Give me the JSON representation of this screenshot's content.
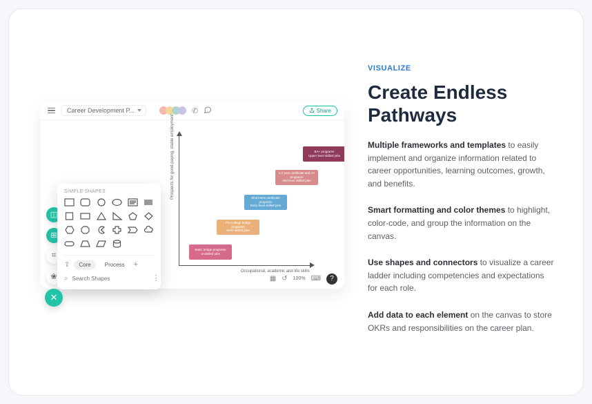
{
  "toolbar": {
    "doc_title": "Career Development P...",
    "share_label": "Share"
  },
  "axes": {
    "ylabel": "Prospects  for  good-paying,  stable  employment",
    "xlabel": "Occupational,  academic  and  life  skills"
  },
  "blocks": {
    "b1": {
      "line1": "BA+ programs",
      "line2": "Upper  level  skilled  jobs"
    },
    "b2": {
      "line1": "1-2 year  certificate  and  AA programs",
      "line2": "Mid-level  skilled  jobs"
    },
    "b3": {
      "line1": "Short-term  certificate  programs",
      "line2": "Entry  level  skilled  jobs"
    },
    "b4": {
      "line1": "Pre-college  bridge  programs",
      "line2": "Semi-skilled  jobs"
    },
    "b5": {
      "line1": "Basic  bridge  programs",
      "line2": "Unskilled  jobs"
    }
  },
  "panel": {
    "title": "SIMPLE SHAPES",
    "tag_core": "Core",
    "tag_process": "Process",
    "search_placeholder": "Search Shapes"
  },
  "bottombar": {
    "zoom": "100%"
  },
  "marketing": {
    "eyebrow": "VISUALIZE",
    "headline": "Create Endless Pathways",
    "p1_strong": "Multiple frameworks and templates",
    "p1_rest": " to easily implement and organize information related to career opportunities, learning outcomes, growth, and benefits.",
    "p2_strong": "Smart formatting and color themes",
    "p2_rest": " to highlight, color-code, and group the information on the canvas.",
    "p3_strong": "Use shapes and connectors",
    "p3_rest": " to visualize a career ladder including competencies and expectations for each role.",
    "p4_strong": "Add data to each element",
    "p4_rest": " on the canvas to store OKRs and responsibilities on the career plan."
  }
}
